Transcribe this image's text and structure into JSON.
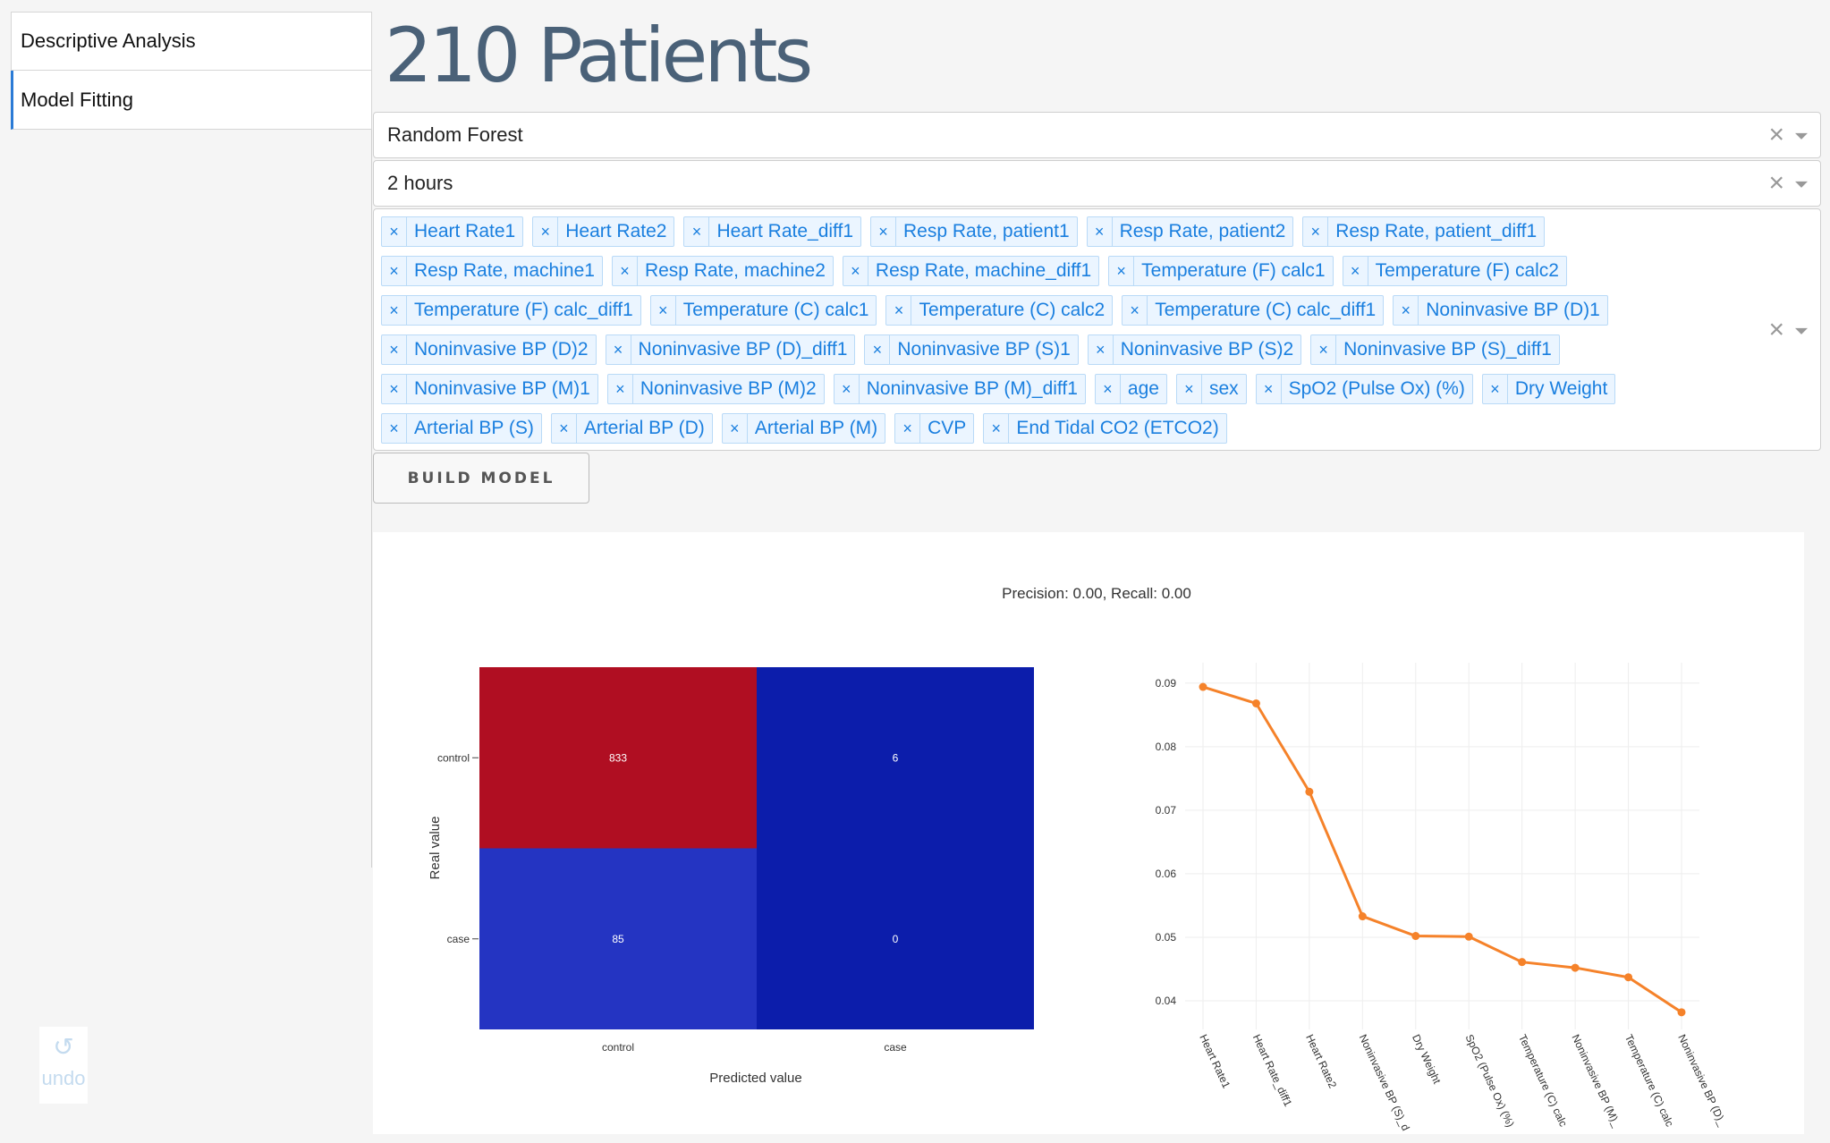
{
  "tabs": [
    {
      "label": "Descriptive Analysis",
      "active": false
    },
    {
      "label": "Model Fitting",
      "active": true
    }
  ],
  "page_title": "210 Patients",
  "model_select": {
    "value": "Random Forest"
  },
  "window_select": {
    "value": "2 hours"
  },
  "features": [
    "Heart Rate1",
    "Heart Rate2",
    "Heart Rate_diff1",
    "Resp Rate, patient1",
    "Resp Rate, patient2",
    "Resp Rate, patient_diff1",
    "Resp Rate, machine1",
    "Resp Rate, machine2",
    "Resp Rate, machine_diff1",
    "Temperature (F) calc1",
    "Temperature (F) calc2",
    "Temperature (F) calc_diff1",
    "Temperature (C) calc1",
    "Temperature (C) calc2",
    "Temperature (C) calc_diff1",
    "Noninvasive BP (D)1",
    "Noninvasive BP (D)2",
    "Noninvasive BP (D)_diff1",
    "Noninvasive BP (S)1",
    "Noninvasive BP (S)2",
    "Noninvasive BP (S)_diff1",
    "Noninvasive BP (M)1",
    "Noninvasive BP (M)2",
    "Noninvasive BP (M)_diff1",
    "age",
    "sex",
    "SpO2 (Pulse Ox) (%)",
    "Dry Weight",
    "Arterial BP (S)",
    "Arterial BP (D)",
    "Arterial BP (M)",
    "CVP",
    "End Tidal CO2 (ETCO2)"
  ],
  "tag_remove_glyph": "×",
  "clear_glyph": "×",
  "build_button": "BUILD MODEL",
  "undo": {
    "label": "undo",
    "icon": "undo-arrow-icon",
    "glyph": "↺"
  },
  "chart_data": [
    {
      "type": "heatmap",
      "title": "Precision: 0.00, Recall: 0.00",
      "xlabel": "Predicted value",
      "ylabel": "Real value",
      "x_categories": [
        "control",
        "case"
      ],
      "y_categories": [
        "control",
        "case"
      ],
      "z": [
        [
          833,
          6
        ],
        [
          85,
          0
        ]
      ],
      "colors": [
        [
          "#b00e22",
          "#0c1dab"
        ],
        [
          "#2434c2",
          "#0c1dab"
        ]
      ]
    },
    {
      "type": "line",
      "categories": [
        "Heart Rate1",
        "Heart Rate_diff1",
        "Heart Rate2",
        "Noninvasive BP (S)_d",
        "Dry Weight",
        "SpO2 (Pulse Ox) (%)",
        "Temperature (C) calc",
        "Noninvasive BP (M)_",
        "Temperature (C) calc",
        "Noninvasive BP (D)_"
      ],
      "values": [
        0.0894,
        0.0868,
        0.0729,
        0.0533,
        0.0502,
        0.0501,
        0.0461,
        0.0452,
        0.0437,
        0.0382
      ],
      "ylim": [
        0.0355,
        0.0925
      ],
      "yticks": [
        "0.04",
        "0.05",
        "0.06",
        "0.07",
        "0.08",
        "0.09"
      ],
      "ytick_values": [
        0.04,
        0.05,
        0.06,
        0.07,
        0.08,
        0.09
      ],
      "grid": true,
      "color": "#f5822a"
    }
  ]
}
